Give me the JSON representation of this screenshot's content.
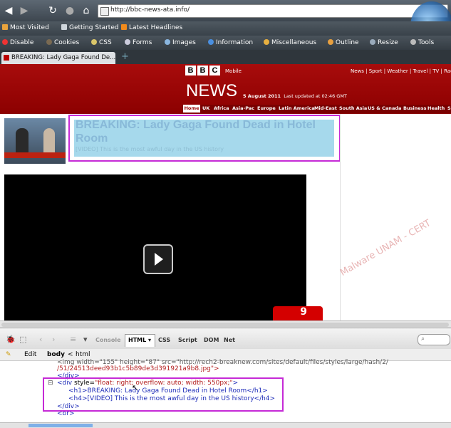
{
  "browser": {
    "url": "http://bbc-news-ata.info/",
    "bookmarks": [
      "Most Visited",
      "Getting Started",
      "Latest Headlines"
    ],
    "webdev_toolbar": [
      "Disable",
      "Cookies",
      "CSS",
      "Forms",
      "Images",
      "Information",
      "Miscellaneous",
      "Outline",
      "Resize",
      "Tools"
    ],
    "tab_title": "BREAKING: Lady Gaga Found De...",
    "new_tab": "+"
  },
  "bbc": {
    "logo_letters": [
      "B",
      "B",
      "C"
    ],
    "mobile": "Mobile",
    "top_links": "News | Sport | Weather | Travel | TV | Radio",
    "news": "NEWS",
    "date": "5 August 2011",
    "updated": "Last updated at 02:46 GMT",
    "nav": [
      "Home",
      "UK",
      "Africa",
      "Asia-Pac",
      "Europe",
      "Latin America",
      "Mid-East",
      "South Asia",
      "US & Canada",
      "Business",
      "Health",
      "S"
    ]
  },
  "article": {
    "headline": "BREAKING: Lady Gaga Found Dead in Hotel Room",
    "subhead": "[VIDEO] This is the most awful day in the US history",
    "badge_count": "9",
    "watermark": "Malware UNAM - CERT"
  },
  "firebug": {
    "tabs": [
      "Console",
      "HTML",
      "CSS",
      "Script",
      "DOM",
      "Net"
    ],
    "active_tab": "HTML",
    "breadcrumb": [
      "Edit",
      "body",
      "<",
      "html"
    ],
    "code": {
      "line0": "<img width=\"155\" height=\"87\" src=\"http://rech2-breaknew.com/sites/default/files/styles/large/hash/2/",
      "line1": "/51/24513deed93b1c5b89de3d391921a9b8.jpg\">",
      "line2": "</div>",
      "line3_tag": "<div",
      "line3_attr": " style=",
      "line3_val": "\"float: right; overflow: auto; width: 550px;\"",
      "line3_end": ">",
      "line4": "<h1>BREAKING: Lady Gaga Found Dead in Hotel Room</h1>",
      "line5": "<h4>[VIDEO] This is the most awful day in the US history</h4>",
      "line6": "</div>",
      "line7": "<br>"
    }
  },
  "colors": {
    "bbc_red": "#a80c0c",
    "highlight_border": "#c52ad6",
    "highlight_fill": "#a6d9ec"
  }
}
